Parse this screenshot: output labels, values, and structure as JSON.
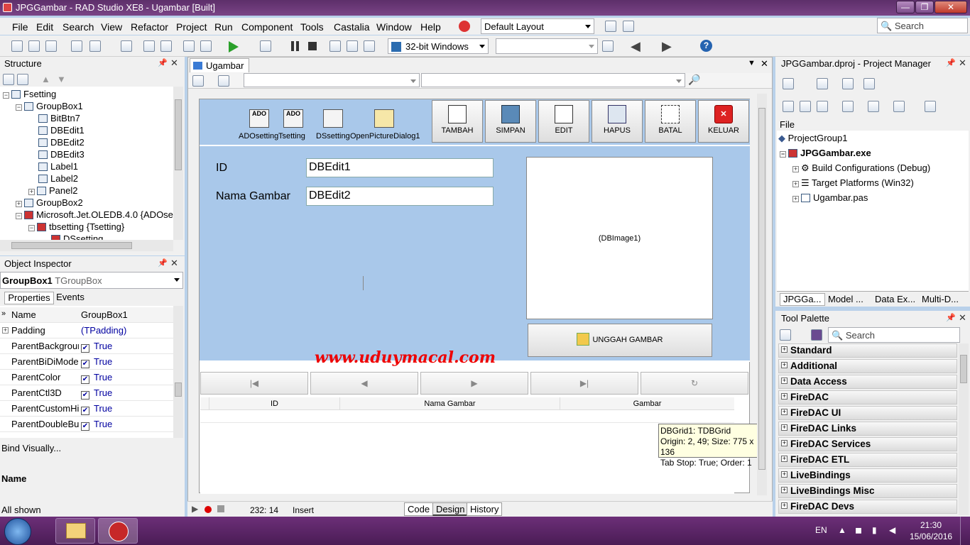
{
  "window": {
    "title": "JPGGambar - RAD Studio XE8 - Ugambar [Built]"
  },
  "menu": [
    "File",
    "Edit",
    "Search",
    "View",
    "Refactor",
    "Project",
    "Run",
    "Component",
    "Tools",
    "Castalia",
    "Window",
    "Help"
  ],
  "layout_combo": "Default Layout",
  "search_placeholder": "Search",
  "platform_combo": "32-bit Windows",
  "structure": {
    "title": "Structure",
    "nodes": [
      "Fsetting",
      "GroupBox1",
      "BitBtn7",
      "DBEdit1",
      "DBEdit2",
      "DBEdit3",
      "Label1",
      "Label2",
      "Panel2",
      "GroupBox2",
      "Microsoft.Jet.OLEDB.4.0 {ADOse",
      "tbsetting {Tsetting}",
      "DSsetting"
    ]
  },
  "object_inspector": {
    "title": "Object Inspector",
    "selected_name": "GroupBox1",
    "selected_type": "TGroupBox",
    "tabs": [
      "Properties",
      "Events"
    ],
    "rows": [
      {
        "name": "Name",
        "value": "GroupBox1",
        "check": false
      },
      {
        "name": "Padding",
        "value": "(TPadding)",
        "check": false
      },
      {
        "name": "ParentBackgrour",
        "value": "True",
        "check": true
      },
      {
        "name": "ParentBiDiMode",
        "value": "True",
        "check": true
      },
      {
        "name": "ParentColor",
        "value": "True",
        "check": true
      },
      {
        "name": "ParentCtl3D",
        "value": "True",
        "check": true
      },
      {
        "name": "ParentCustomHi",
        "value": "True",
        "check": true
      },
      {
        "name": "ParentDoubleBu",
        "value": "True",
        "check": true
      }
    ],
    "bind_visually": "Bind Visually...",
    "footer_label": "Name",
    "status": "All shown"
  },
  "editor": {
    "tab": "Ugambar",
    "components": [
      "ADOsetting",
      "Tsetting",
      "DSsetting",
      "OpenPictureDialog1"
    ],
    "buttons": [
      "TAMBAH",
      "SIMPAN",
      "EDIT",
      "HAPUS",
      "BATAL",
      "KELUAR"
    ],
    "label_id": "ID",
    "label_nama": "Nama Gambar",
    "edit1": "DBEdit1",
    "edit2": "DBEdit2",
    "image": "(DBImage1)",
    "upload": "UNGGAH GAMBAR",
    "watermark": "www.uduymacal.com",
    "grid_cols": [
      "ID",
      "Nama Gambar",
      "Gambar"
    ],
    "hint": [
      "DBGrid1: TDBGrid",
      "Origin: 2, 49; Size: 775 x 136",
      "Tab Stop: True; Order: 1"
    ],
    "status_pos": "232:  14",
    "status_mode": "Insert",
    "bottom_tabs": [
      "Code",
      "Design",
      "History"
    ]
  },
  "project_manager": {
    "title": "JPGGambar.dproj - Project Manager",
    "file_label": "File",
    "nodes": [
      "ProjectGroup1",
      "JPGGambar.exe",
      "Build Configurations (Debug)",
      "Target Platforms (Win32)",
      "Ugambar.pas"
    ],
    "tabs": [
      "JPGGa...",
      "Model ...",
      "Data Ex...",
      "Multi-D..."
    ]
  },
  "tool_palette": {
    "title": "Tool Palette",
    "search": "Search",
    "categories": [
      "Standard",
      "Additional",
      "Data Access",
      "FireDAC",
      "FireDAC UI",
      "FireDAC Links",
      "FireDAC Services",
      "FireDAC ETL",
      "LiveBindings",
      "LiveBindings Misc",
      "FireDAC Devs"
    ]
  },
  "tray": {
    "lang": "EN",
    "time": "21:30",
    "date": "15/06/2016"
  }
}
